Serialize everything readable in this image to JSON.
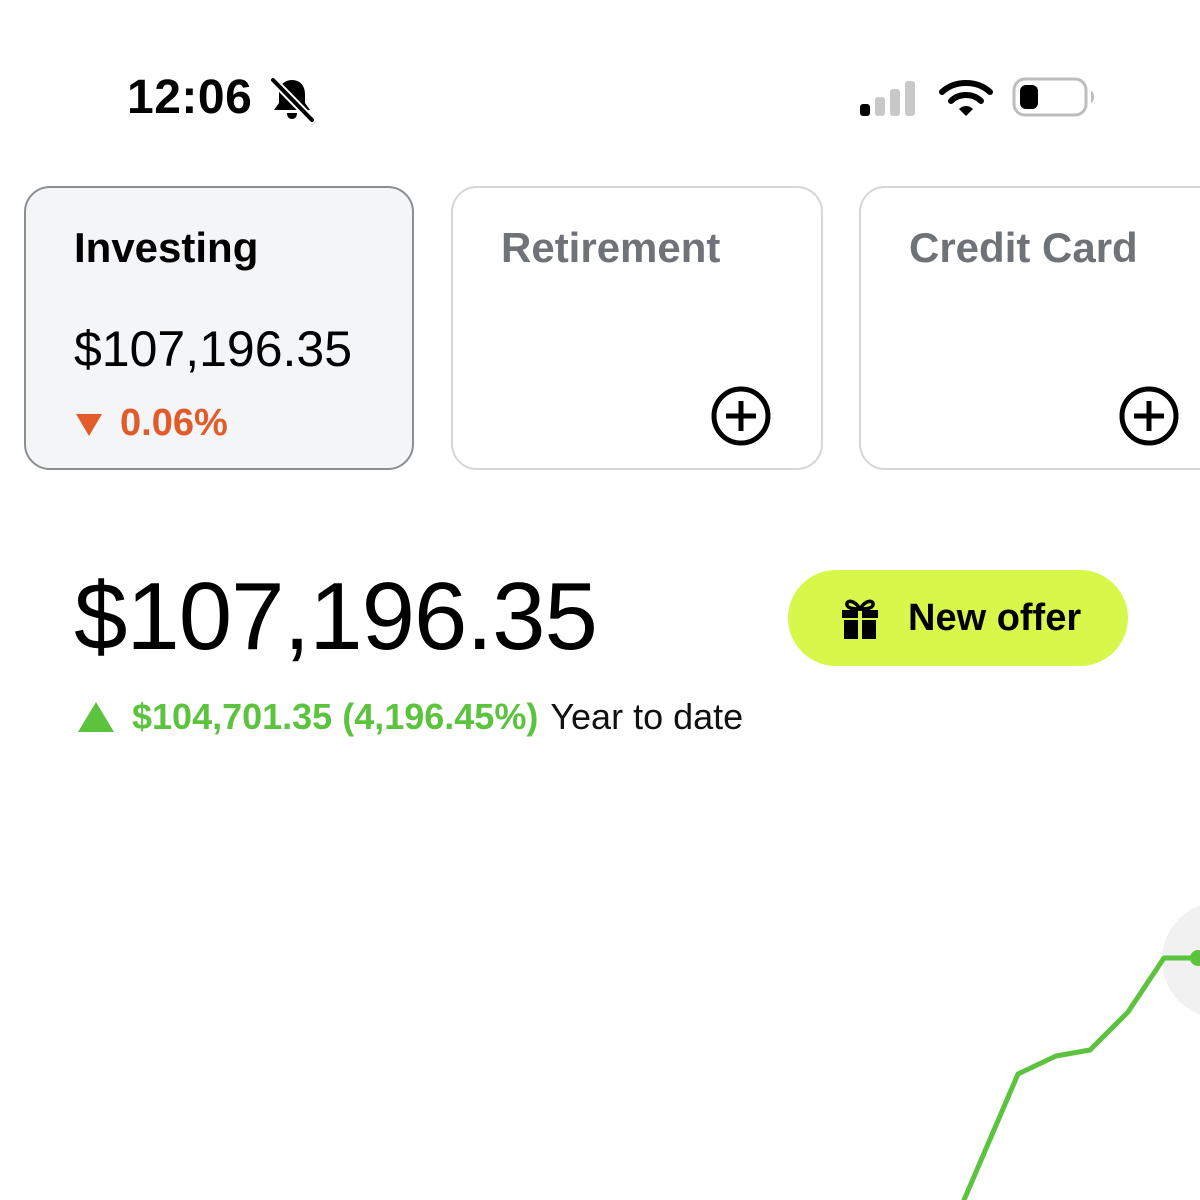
{
  "status_bar": {
    "time": "12:06",
    "icons": [
      "bell-slash-icon",
      "cellular-signal-icon",
      "wifi-icon",
      "battery-icon"
    ]
  },
  "accounts": {
    "tabs": [
      {
        "label": "Investing",
        "value": "$107,196.35",
        "change": "0.06%",
        "change_direction": "down",
        "selected": true
      },
      {
        "label": "Retirement",
        "action_icon": "plus-circle-icon"
      },
      {
        "label": "Credit Card",
        "action_icon": "plus-circle-icon"
      }
    ]
  },
  "portfolio": {
    "balance": "$107,196.35",
    "change": "$104,701.35 (4,196.45%)",
    "change_direction": "up",
    "period_label": "Year to date"
  },
  "offer": {
    "label": "New offer",
    "icon": "gift-icon"
  },
  "colors": {
    "positive": "#5cc33f",
    "negative": "#e25c2b",
    "offer_background": "#d7f84a"
  }
}
